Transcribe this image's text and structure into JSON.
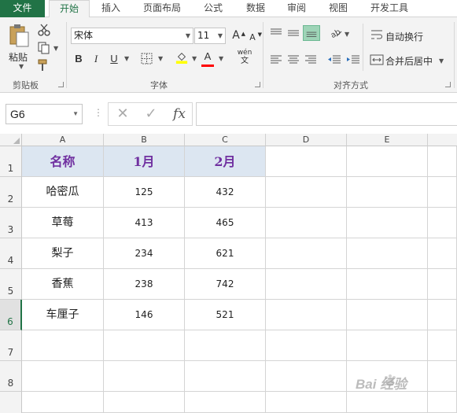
{
  "ribbon_tabs": [
    "文件",
    "开始",
    "插入",
    "页面布局",
    "公式",
    "数据",
    "审阅",
    "视图",
    "开发工具"
  ],
  "active_tab": "开始",
  "clipboard": {
    "paste_label": "粘贴",
    "group_label": "剪贴板"
  },
  "font": {
    "name": "宋体",
    "size": "11",
    "group_label": "字体",
    "phonetic_top": "wén",
    "phonetic_bottom": "文",
    "bold": "B",
    "italic": "I",
    "underline": "U",
    "grow": "A",
    "shrink": "A",
    "font_color_letter": "A",
    "font_color": "#ff0000",
    "fill_color": "#ffff00"
  },
  "alignment": {
    "wrap_text": "自动换行",
    "merge_center": "合并后居中",
    "group_label": "对齐方式"
  },
  "formula_bar": {
    "name_box": "G6",
    "cancel_icon": "✕",
    "enter_icon": "✓",
    "fx_label": "fx",
    "value": ""
  },
  "grid": {
    "columns": [
      "A",
      "B",
      "C",
      "D",
      "E"
    ],
    "rows": [
      "1",
      "2",
      "3",
      "4",
      "5",
      "6",
      "7",
      "8"
    ],
    "active_row": "6",
    "header": [
      "名称",
      "1月",
      "2月"
    ],
    "data": [
      [
        "哈密瓜",
        "125",
        "432"
      ],
      [
        "草莓",
        "413",
        "465"
      ],
      [
        "梨子",
        "234",
        "621"
      ],
      [
        "香蕉",
        "238",
        "742"
      ],
      [
        "车厘子",
        "146",
        "521"
      ]
    ]
  },
  "watermark": {
    "text": "Bai  经验"
  },
  "colors": {
    "excel_green": "#217346",
    "header_fill": "#dce6f1",
    "header_text": "#7030a0"
  }
}
